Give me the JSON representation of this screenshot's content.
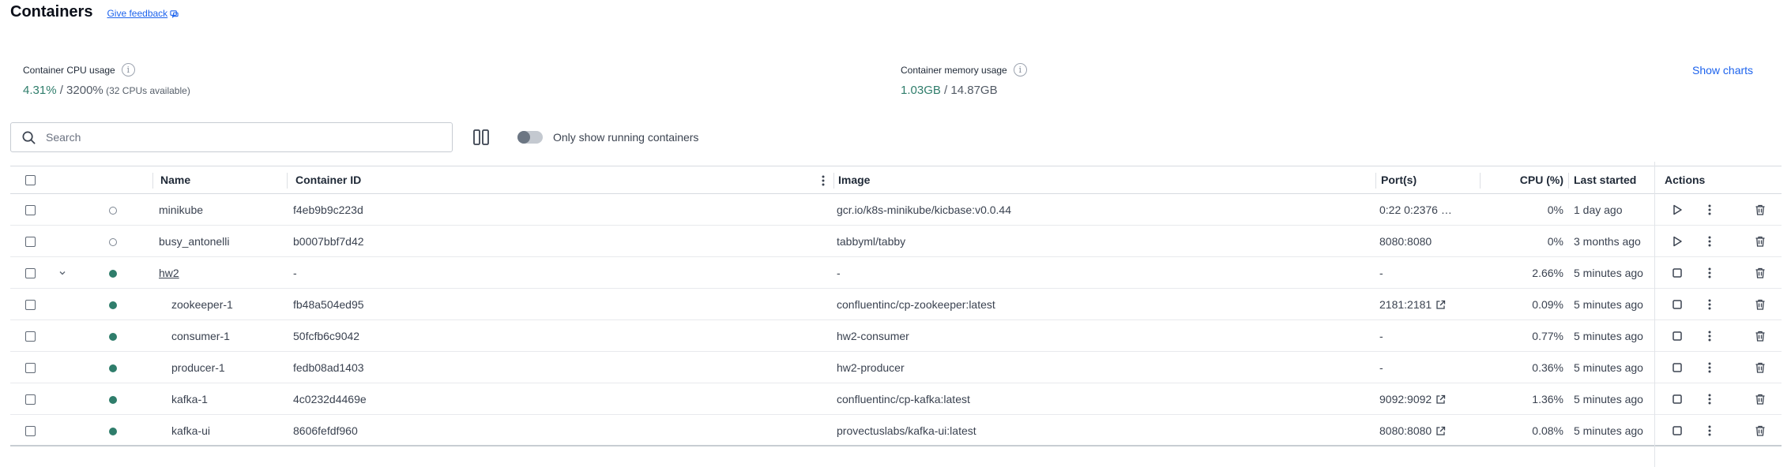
{
  "header": {
    "title": "Containers",
    "feedback_label": "Give feedback"
  },
  "stats": {
    "cpu": {
      "label": "Container CPU usage",
      "used": "4.31%",
      "total": " / 3200%",
      "note": " (32 CPUs available)"
    },
    "memory": {
      "label": "Container memory usage",
      "used": "1.03GB",
      "total": " / 14.87GB"
    },
    "show_charts_label": "Show charts"
  },
  "toolbar": {
    "search_placeholder": "Search",
    "running_only_label": "Only show running containers"
  },
  "table": {
    "columns": {
      "name": "Name",
      "container_id": "Container ID",
      "image": "Image",
      "ports": "Port(s)",
      "cpu": "CPU (%)",
      "last_started": "Last started",
      "actions": "Actions"
    },
    "rows": [
      {
        "name": "minikube",
        "id": "f4eb9b9c223d",
        "image": "gcr.io/k8s-minikube/kicbase:v0.0.44",
        "ports": "0:22  0:2376  …",
        "cpu": "0%",
        "last_started": "1 day ago"
      },
      {
        "name": "busy_antonelli",
        "id": "b0007bbf7d42",
        "image": "tabbyml/tabby",
        "ports": "8080:8080",
        "cpu": "0%",
        "last_started": "3 months ago"
      },
      {
        "name": "hw2",
        "id": "-",
        "image": "-",
        "ports": "-",
        "cpu": "2.66%",
        "last_started": "5 minutes ago"
      },
      {
        "name": "zookeeper-1",
        "id": "fb48a504ed95",
        "image": "confluentinc/cp-zookeeper:latest",
        "ports": "2181:2181",
        "cpu": "0.09%",
        "last_started": "5 minutes ago"
      },
      {
        "name": "consumer-1",
        "id": "50fcfb6c9042",
        "image": "hw2-consumer",
        "ports": "-",
        "cpu": "0.77%",
        "last_started": "5 minutes ago"
      },
      {
        "name": "producer-1",
        "id": "fedb08ad1403",
        "image": "hw2-producer",
        "ports": "-",
        "cpu": "0.36%",
        "last_started": "5 minutes ago"
      },
      {
        "name": "kafka-1",
        "id": "4c0232d4469e",
        "image": "confluentinc/cp-kafka:latest",
        "ports": "9092:9092",
        "cpu": "1.36%",
        "last_started": "5 minutes ago"
      },
      {
        "name": "kafka-ui",
        "id": "8606fefdf960",
        "image": "provectuslabs/kafka-ui:latest",
        "ports": "8080:8080",
        "cpu": "0.08%",
        "last_started": "5 minutes ago"
      }
    ]
  },
  "colors": {
    "accent": "#2f7d6b",
    "link": "#1d63ed",
    "running": "#2f7d6b"
  }
}
